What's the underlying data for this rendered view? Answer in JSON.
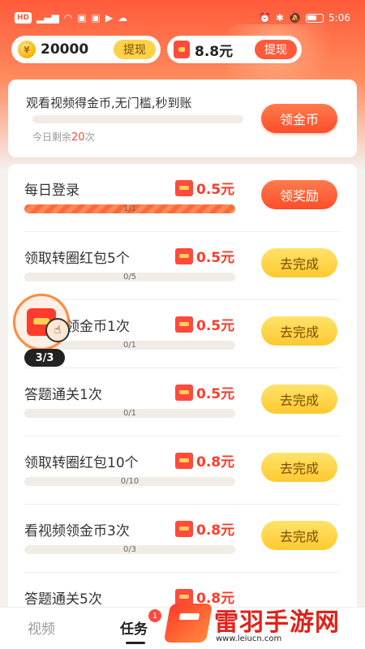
{
  "status_bar": {
    "left_chips": [
      "HD",
      "5G"
    ],
    "time": "5:06"
  },
  "wallet": {
    "coins": "20000",
    "coins_withdraw": "提现",
    "cash": "8.8元",
    "cash_withdraw": "提现"
  },
  "video_task": {
    "title": "观看视频得金币,无门槛,秒到账",
    "remain_prefix": "今日剩余",
    "remain_count": "20",
    "remain_suffix": "次",
    "button": "领金币"
  },
  "tasks": [
    {
      "name": "每日登录",
      "reward": "0.5元",
      "progress_text": "1/1",
      "progress": 1.0,
      "button": "领奖励",
      "button_style": "claim"
    },
    {
      "name": "领取转圈红包5个",
      "reward": "0.5元",
      "progress_text": "0/5",
      "progress": 0.0,
      "button": "去完成",
      "button_style": "go"
    },
    {
      "name": "看视频领金币1次",
      "reward": "0.5元",
      "progress_text": "0/1",
      "progress": 0.0,
      "button": "去完成",
      "button_style": "go"
    },
    {
      "name": "答题通关1次",
      "reward": "0.5元",
      "progress_text": "0/1",
      "progress": 0.0,
      "button": "去完成",
      "button_style": "go"
    },
    {
      "name": "领取转圈红包10个",
      "reward": "0.8元",
      "progress_text": "0/10",
      "progress": 0.0,
      "button": "去完成",
      "button_style": "go"
    },
    {
      "name": "看视频领金币3次",
      "reward": "0.8元",
      "progress_text": "0/3",
      "progress": 0.0,
      "button": "去完成",
      "button_style": "go"
    },
    {
      "name": "答题通关5次",
      "reward": "0.8元",
      "progress_text": "",
      "progress": 0.0,
      "button": "",
      "button_style": "go"
    }
  ],
  "float_widget": {
    "count": "3/3"
  },
  "bottom_nav": {
    "tabs": [
      "视频",
      "任务"
    ],
    "active": "任务",
    "badge": "1"
  },
  "watermark": {
    "title": "雷羽手游网",
    "url": "www.leiucn.com"
  },
  "colors": {
    "accent": "#ff4a3d",
    "go_button": "#ffc92e",
    "progress_fill": "#ff6a3a"
  }
}
